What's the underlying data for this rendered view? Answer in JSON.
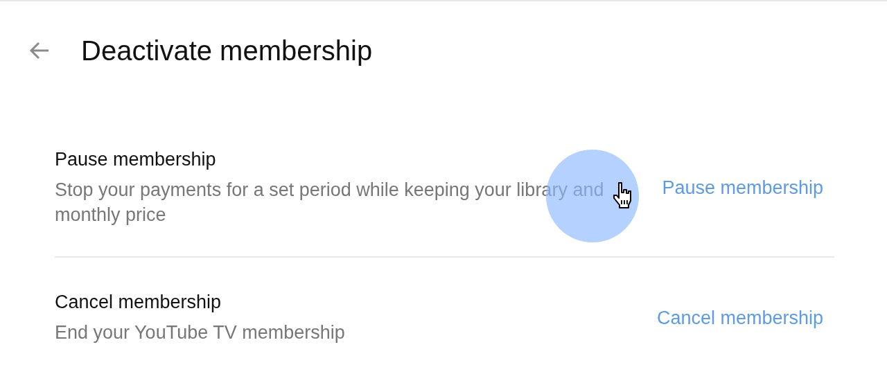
{
  "header": {
    "title": "Deactivate membership"
  },
  "options": [
    {
      "title": "Pause membership",
      "description": "Stop your payments for a set period while keeping your library and monthly price",
      "action": "Pause membership"
    },
    {
      "title": "Cancel membership",
      "description": "End your YouTube TV membership",
      "action": "Cancel membership"
    }
  ]
}
